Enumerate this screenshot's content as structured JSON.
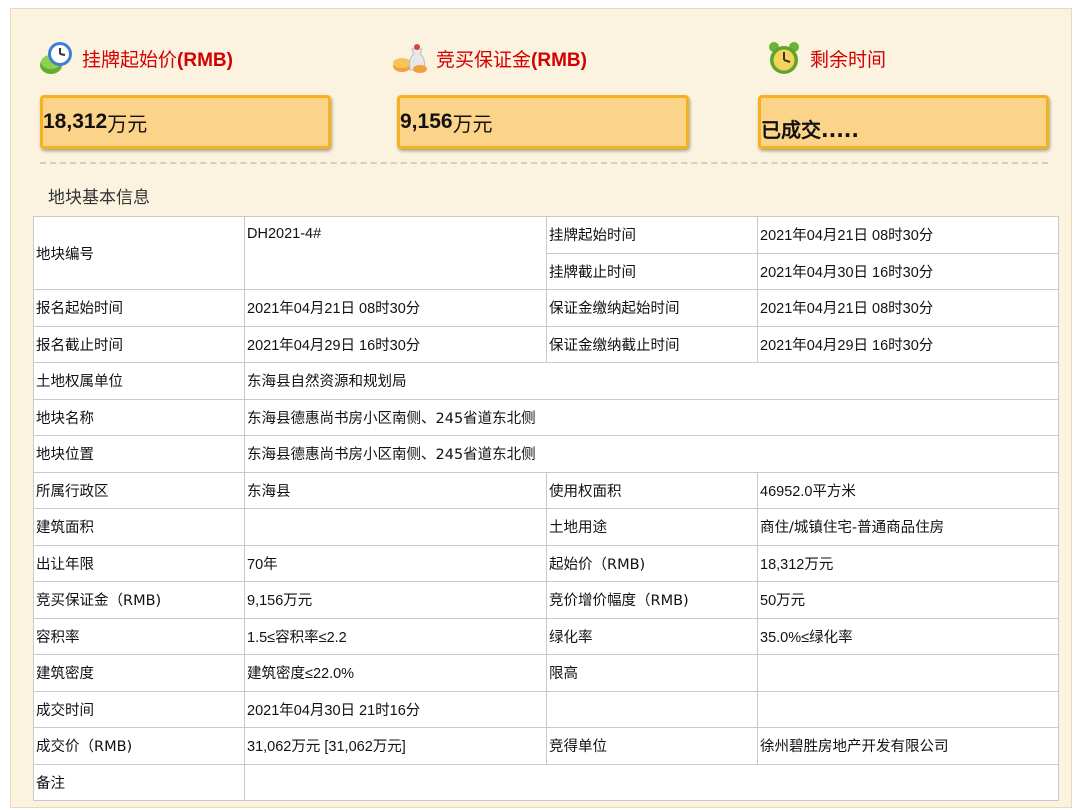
{
  "summary": {
    "start_price_label": "挂牌起始价",
    "start_price_unit_tag": "(RMB)",
    "start_price_value": "18,312",
    "start_price_unit": "万元",
    "deposit_label": "竞买保证金",
    "deposit_unit_tag": "(RMB)",
    "deposit_value": "9,156",
    "deposit_unit": "万元",
    "remaining_label": "剩余时间",
    "remaining_value": "已成交.....",
    "icons": [
      "money-clock-icon",
      "coins-bag-icon",
      "alarm-clock-icon"
    ]
  },
  "section_title": "地块基本信息",
  "table": {
    "parcel_no_label": "地块编号",
    "parcel_no": "DH2021-4#",
    "list_start_label": "挂牌起始时间",
    "list_start": "2021年04月21日 08时30分",
    "list_end_label": "挂牌截止时间",
    "list_end": "2021年04月30日 16时30分",
    "reg_start_label": "报名起始时间",
    "reg_start": "2021年04月21日 08时30分",
    "dep_start_label": "保证金缴纳起始时间",
    "dep_start": "2021年04月21日 08时30分",
    "reg_end_label": "报名截止时间",
    "reg_end": "2021年04月29日 16时30分",
    "dep_end_label": "保证金缴纳截止时间",
    "dep_end": "2021年04月29日 16时30分",
    "owner_label": "土地权属单位",
    "owner": "东海县自然资源和规划局",
    "name_label": "地块名称",
    "name": "东海县德惠尚书房小区南侧、245省道东北侧",
    "location_label": "地块位置",
    "location": "东海县德惠尚书房小区南侧、245省道东北侧",
    "district_label": "所属行政区",
    "district": "东海县",
    "use_area_label": "使用权面积",
    "use_area": "46952.0平方米",
    "build_area_label": "建筑面积",
    "build_area": "",
    "land_use_label": "土地用途",
    "land_use": "商住/城镇住宅-普通商品住房",
    "term_label": "出让年限",
    "term": "70年",
    "start_price_label": "起始价（RMB)",
    "start_price": "18,312万元",
    "deposit_label": "竞买保证金（RMB)",
    "deposit": "9,156万元",
    "increment_label": "竞价增价幅度（RMB)",
    "increment": "50万元",
    "far_label": "容积率",
    "far": "1.5≤容积率≤2.2",
    "green_label": "绿化率",
    "green": "35.0%≤绿化率",
    "density_label": "建筑密度",
    "density": "建筑密度≤22.0%",
    "height_label": "限高",
    "height": "",
    "deal_time_label": "成交时间",
    "deal_time": "2021年04月30日 21时16分",
    "deal_price_label": "成交价（RMB)",
    "deal_price": "31,062万元 [31,062万元]",
    "winner_label": "竞得单位",
    "winner": "徐州碧胜房地产开发有限公司",
    "remark_label": "备注",
    "remark": ""
  }
}
